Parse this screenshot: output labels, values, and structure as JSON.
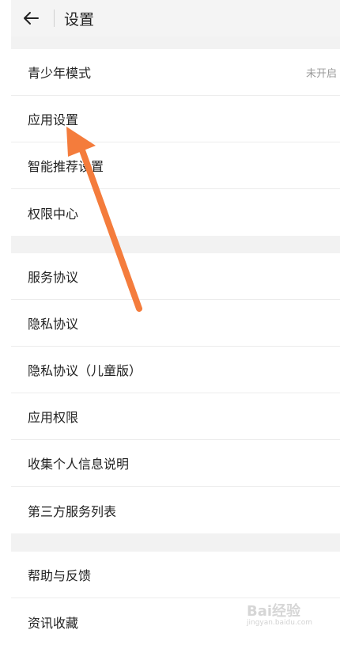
{
  "header": {
    "title": "设置"
  },
  "groups": [
    {
      "items": [
        {
          "label": "青少年模式",
          "value": "未开启"
        },
        {
          "label": "应用设置"
        },
        {
          "label": "智能推荐设置"
        },
        {
          "label": "权限中心"
        }
      ]
    },
    {
      "items": [
        {
          "label": "服务协议"
        },
        {
          "label": "隐私协议"
        },
        {
          "label": "隐私协议（儿童版）"
        },
        {
          "label": "应用权限"
        },
        {
          "label": "收集个人信息说明"
        },
        {
          "label": "第三方服务列表"
        }
      ]
    },
    {
      "items": [
        {
          "label": "帮助与反馈"
        },
        {
          "label": "资讯收藏"
        }
      ]
    }
  ],
  "annotation": {
    "arrow_color": "#f47c3c"
  },
  "watermark": {
    "logo": "Bai经验",
    "url": "jingyan.baidu.com"
  }
}
